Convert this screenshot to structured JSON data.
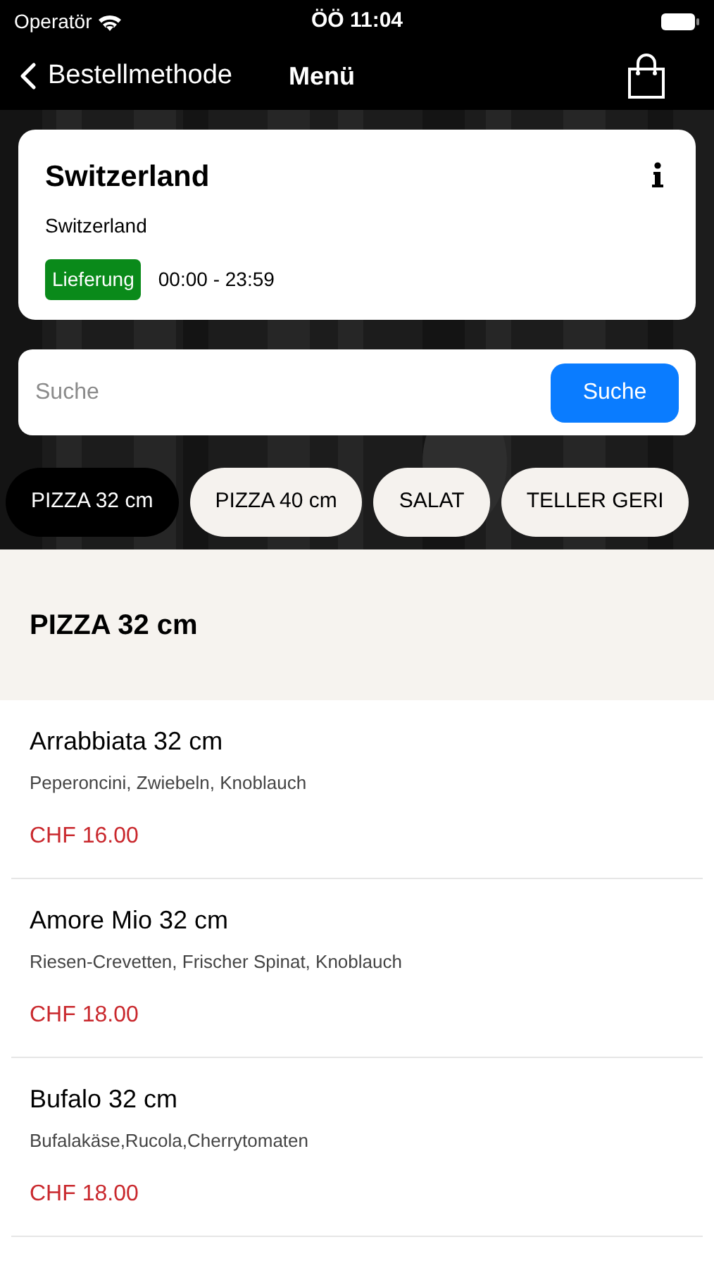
{
  "status_bar": {
    "carrier": "Operatör",
    "time": "ÖÖ 11:04"
  },
  "nav": {
    "back_label": "Bestellmethode",
    "title": "Menü"
  },
  "store": {
    "name": "Switzerland",
    "subtitle": "Switzerland",
    "badge": "Lieferung",
    "hours": "00:00 - 23:59"
  },
  "search": {
    "placeholder": "Suche",
    "button": "Suche"
  },
  "categories": [
    {
      "label": "PIZZA 32 cm",
      "selected": true
    },
    {
      "label": "PIZZA 40 cm",
      "selected": false
    },
    {
      "label": "SALAT",
      "selected": false
    },
    {
      "label": "TELLER GERI",
      "selected": false
    }
  ],
  "section": {
    "title": "PIZZA 32 cm"
  },
  "items": [
    {
      "name": "Arrabbiata 32 cm",
      "description": "Peperoncini, Zwiebeln, Knoblauch",
      "price": "CHF 16.00"
    },
    {
      "name": "Amore Mio 32 cm",
      "description": "Riesen-Crevetten, Frischer Spinat, Knoblauch",
      "price": "CHF 18.00"
    },
    {
      "name": "Bufalo 32 cm",
      "description": "Bufalakäse,Rucola,Cherrytomaten",
      "price": "CHF 18.00"
    }
  ]
}
